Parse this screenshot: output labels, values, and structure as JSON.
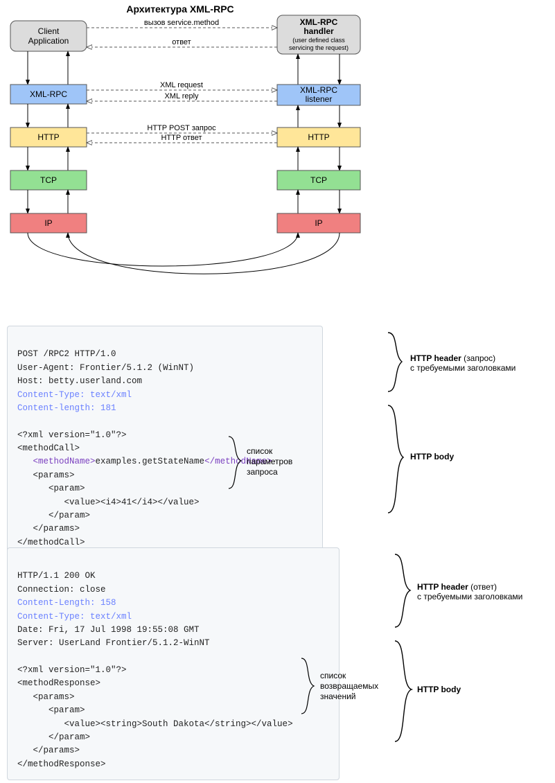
{
  "diagram": {
    "title": "Архитектура XML-RPC",
    "left_stack": {
      "client": {
        "label": "Client",
        "sublabel": "Application"
      },
      "xmlrpc": {
        "label": "XML-RPC"
      },
      "http": {
        "label": "HTTP"
      },
      "tcp": {
        "label": "TCP"
      },
      "ip": {
        "label": "IP"
      }
    },
    "right_stack": {
      "handler": {
        "label1": "XML-RPC",
        "label2": "handler",
        "sub1": "(user defined class",
        "sub2": "servicing the request)"
      },
      "listener": {
        "label1": "XML-RPC",
        "label2": "listener"
      },
      "http": {
        "label": "HTTP"
      },
      "tcp": {
        "label": "TCP"
      },
      "ip": {
        "label": "IP"
      }
    },
    "edges": {
      "call": "вызов service.method",
      "reply": "ответ",
      "xml_req": "XML request",
      "xml_rep": "XML reply",
      "http_post": "HTTP POST запрос",
      "http_reply": "HTTP ответ"
    }
  },
  "request": {
    "line1": "POST /RPC2 HTTP/1.0",
    "line2": "User-Agent: Frontier/5.1.2 (WinNT)",
    "line3": "Host: betty.userland.com",
    "line4": "Content-Type: text/xml",
    "line5": "Content-length: 181",
    "line6": "<?xml version=\"1.0\"?>",
    "line7": "<methodCall>",
    "line8a": "<methodName>",
    "line8b": "examples.getStateName",
    "line8c": "</methodName>",
    "line9": "   <params>",
    "line10": "      <param>",
    "line11": "         <value><i4>41</i4></value>",
    "line12": "      </param>",
    "line13": "   </params>",
    "line14": "</methodCall>"
  },
  "request_ann": {
    "header_b": "HTTP header",
    "header_t": " (запрос)",
    "header_sub": "с требуемыми заголовками",
    "body_b": "HTTP body",
    "params1": "список",
    "params2": "параметров",
    "params3": "запроса"
  },
  "response": {
    "line1": "HTTP/1.1 200 OK",
    "line2": "Connection: close",
    "line3": "Content-Length: 158",
    "line4": "Content-Type: text/xml",
    "line5": "Date: Fri, 17 Jul 1998 19:55:08 GMT",
    "line6": "Server: UserLand Frontier/5.1.2-WinNT",
    "line7": "<?xml version=\"1.0\"?>",
    "line8": "<methodResponse>",
    "line9": "   <params>",
    "line10": "      <param>",
    "line11": "         <value><string>South Dakota</string></value>",
    "line12": "      </param>",
    "line13": "   </params>",
    "line14": "</methodResponse>"
  },
  "response_ann": {
    "header_b": "HTTP header",
    "header_t": " (ответ)",
    "header_sub": "с требуемыми заголовками",
    "body_b": "HTTP body",
    "params1": "список",
    "params2": "возвращаемых",
    "params3": "значений"
  }
}
